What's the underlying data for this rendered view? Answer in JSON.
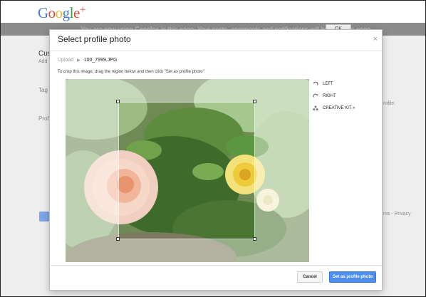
{
  "brand": {
    "logo_main": "Google",
    "logo_plus": "+"
  },
  "notice": {
    "text": "You are now using Google+ in this page. Your posts, comments and notifications will be from this page.",
    "button_label": "OK"
  },
  "background": {
    "heading": "Cus",
    "sub": "Add",
    "label_tag": "Tag",
    "label_profile": "Profi",
    "right_text": "rofile.",
    "footer_links": "ms - Privacy"
  },
  "dialog": {
    "title": "Select profile photo",
    "close_label": "×",
    "breadcrumb": {
      "upload": "Upload",
      "filename": "100_7999.JPG"
    },
    "instructions": "To crop this image, drag the region below and then click \"Set as profile photo\"",
    "tools": [
      {
        "label": "LEFT",
        "icon": "rotate-left-icon"
      },
      {
        "label": "RIGHT",
        "icon": "rotate-right-icon"
      },
      {
        "label": "CREATIVE KIT »",
        "icon": "creative-kit-icon"
      }
    ],
    "cancel_label": "Cancel",
    "set_label": "Set as profile photo"
  },
  "colors": {
    "primary_button": "#4d8ef0",
    "notice_bar": "#8c8c8c"
  }
}
